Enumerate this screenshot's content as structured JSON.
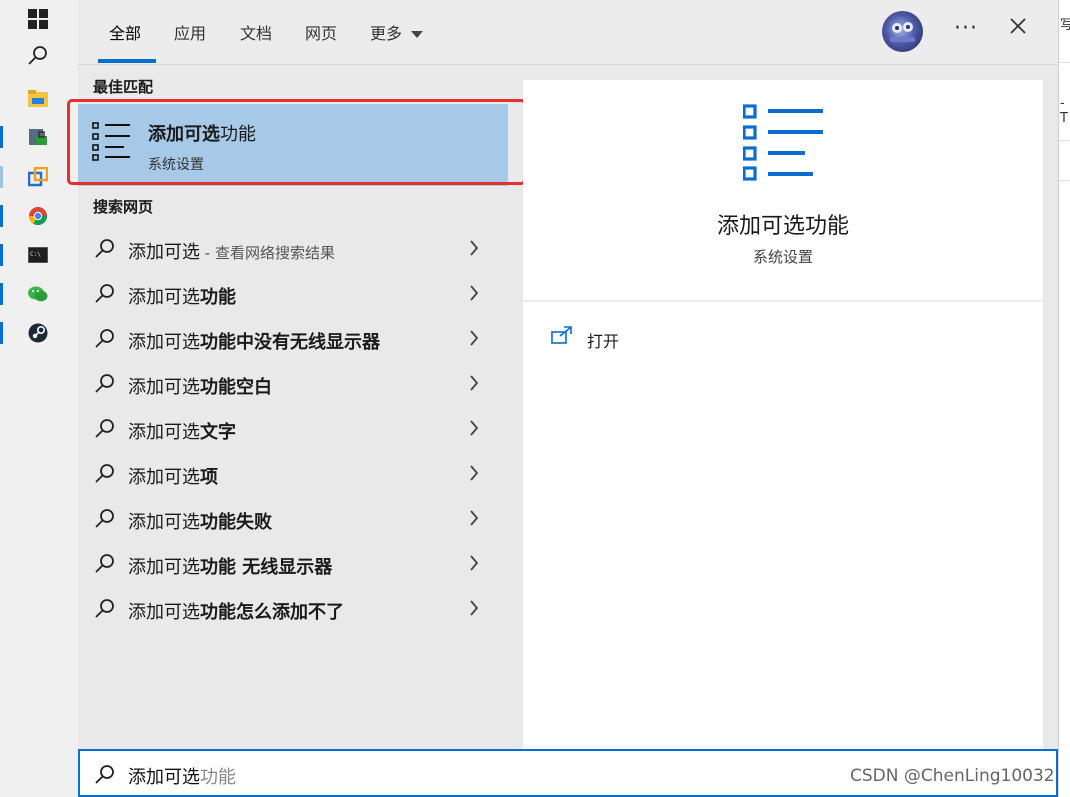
{
  "tabs": [
    {
      "label": "全部",
      "active": true
    },
    {
      "label": "应用",
      "active": false
    },
    {
      "label": "文档",
      "active": false
    },
    {
      "label": "网页",
      "active": false
    },
    {
      "label": "更多",
      "active": false
    }
  ],
  "header": {
    "more_icon": "ellipsis-icon",
    "close_icon": "close-icon",
    "avatar_icon": "user-avatar"
  },
  "best_match": {
    "section_title": "最佳匹配",
    "title_bold": "添加可选",
    "title_rest": "功能",
    "subtitle": "系统设置",
    "icon": "list-settings-icon",
    "highlight_color": "#e4312b"
  },
  "web_search": {
    "section_title": "搜索网页",
    "items": [
      {
        "plain": "添加可选",
        "bold": "",
        "hint": " - 查看网络搜索结果"
      },
      {
        "plain": "添加可选",
        "bold": "功能",
        "hint": ""
      },
      {
        "plain": "添加可选",
        "bold": "功能中没有无线显示器",
        "hint": ""
      },
      {
        "plain": "添加可选",
        "bold": "功能空白",
        "hint": ""
      },
      {
        "plain": "添加可选",
        "bold": "文字",
        "hint": ""
      },
      {
        "plain": "添加可选",
        "bold": "项",
        "hint": ""
      },
      {
        "plain": "添加可选",
        "bold": "功能失败",
        "hint": ""
      },
      {
        "plain": "添加可选",
        "bold": "功能 无线显示器",
        "hint": ""
      },
      {
        "plain": "添加可选",
        "bold": "功能怎么添加不了",
        "hint": ""
      }
    ]
  },
  "detail": {
    "title": "添加可选功能",
    "subtitle": "系统设置",
    "open_label": "打开",
    "open_icon": "open-external-icon"
  },
  "search_box": {
    "typed": "添加可选",
    "suggestion": "功能"
  },
  "watermark": "CSDN @ChenLing10032",
  "background_window": {
    "fragments": [
      "写",
      "-T"
    ]
  },
  "taskbar": {
    "icons": [
      "windows-start-icon",
      "search-icon",
      "file-explorer-icon",
      "lock-app-icon",
      "virtualbox-icon",
      "chrome-icon",
      "terminal-icon",
      "wechat-icon",
      "steam-icon"
    ]
  },
  "colors": {
    "accent": "#0a6ed1",
    "selected_bg": "#a7c9e8",
    "panel_bg": "#e9e9e9"
  }
}
